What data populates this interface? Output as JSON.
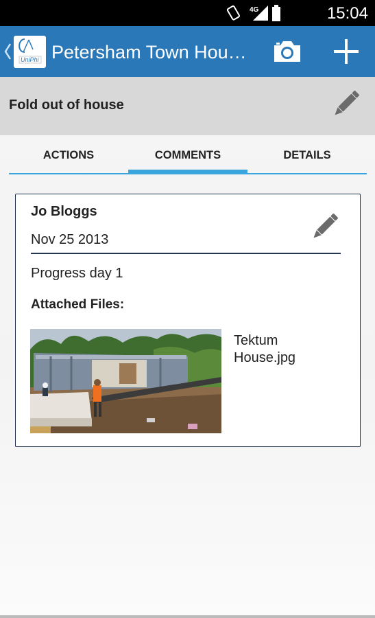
{
  "status_bar": {
    "time": "15:04",
    "network_label": "4G",
    "icons": [
      "rotate-icon",
      "signal-icon",
      "battery-icon"
    ]
  },
  "action_bar": {
    "title": "Petersham Town Hou…",
    "logo_text": "UniPhi",
    "actions": [
      "camera-icon",
      "add-icon"
    ],
    "background_color": "#2b78b8"
  },
  "sub_header": {
    "title": "Fold out of house"
  },
  "tabs": [
    {
      "label": "ACTIONS",
      "active": false
    },
    {
      "label": "COMMENTS",
      "active": true
    },
    {
      "label": "DETAILS",
      "active": false
    }
  ],
  "comment": {
    "author": "Jo Bloggs",
    "date": "Nov 25 2013",
    "text": "Progress day 1",
    "attached_files_label": "Attached Files:",
    "files": [
      {
        "name": "Tektum House.jpg"
      }
    ]
  },
  "colors": {
    "accent": "#3aa4dd",
    "card_border": "#23344f"
  }
}
